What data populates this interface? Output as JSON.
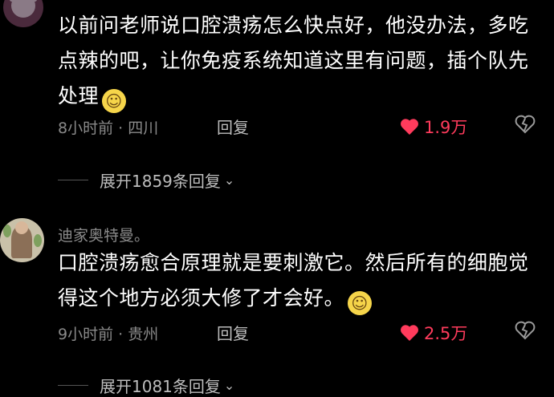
{
  "comments": [
    {
      "text": "以前问老师说口腔溃疡怎么快点好，他没办法，多吃点辣的吧，让你免疫系统知道这里有问题，插个队先处理",
      "emoji": "smile-face",
      "meta": "8小时前 · 四川",
      "reply_label": "回复",
      "likes": "1.9万",
      "expand_label": "展开1859条回复"
    },
    {
      "username": "迪家奥特曼。",
      "text": "口腔溃疡愈合原理就是要刺激它。然后所有的细胞觉得这个地方必须大修了才会好。",
      "emoji": "smile-face",
      "meta": "9小时前 · 贵州",
      "reply_label": "回复",
      "likes": "2.5万",
      "expand_label": "展开1081条回复"
    }
  ],
  "colors": {
    "like": "#ff3b5c",
    "secondary_text": "#8a8a8a",
    "background": "#000000"
  }
}
